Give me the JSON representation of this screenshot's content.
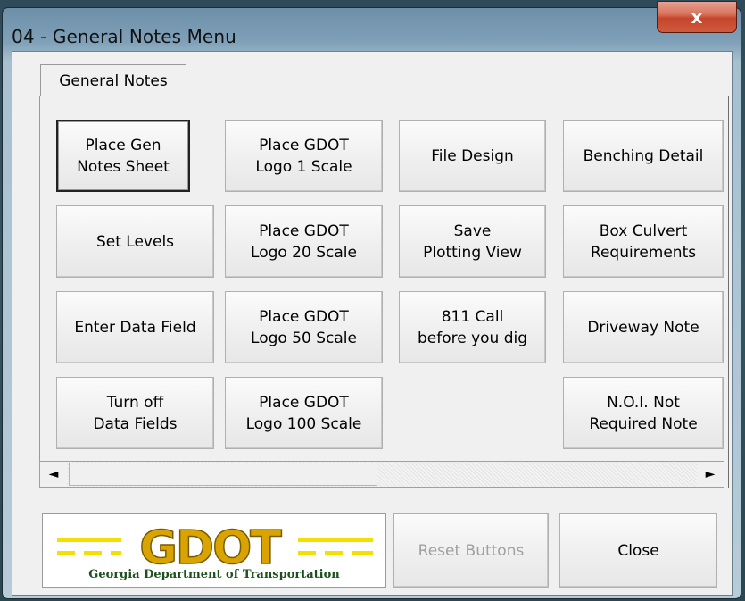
{
  "window": {
    "title": "04 - General Notes Menu",
    "close_glyph": "x"
  },
  "tabs": [
    {
      "label": "General Notes",
      "selected": true
    }
  ],
  "buttons": {
    "place_gen_notes_sheet": "Place Gen\nNotes Sheet",
    "place_gdot_logo_1": "Place GDOT\nLogo 1 Scale",
    "file_design": "File Design",
    "benching_detail": "Benching Detail",
    "set_levels": "Set Levels",
    "place_gdot_logo_20": "Place GDOT\nLogo 20 Scale",
    "save_plotting_view": "Save\nPlotting View",
    "box_culvert_requirements": "Box Culvert\nRequirements",
    "enter_data_field": "Enter Data Field",
    "place_gdot_logo_50": "Place GDOT\nLogo 50 Scale",
    "call_811": "811 Call\nbefore you dig",
    "driveway_note": "Driveway Note",
    "turn_off_data_fields": "Turn off\nData Fields",
    "place_gdot_logo_100": "Place GDOT\nLogo 100 Scale",
    "noi_not_required_note": "N.O.I. Not\nRequired Note"
  },
  "scrollbar": {
    "left_arrow": "◄",
    "right_arrow": "►"
  },
  "logo": {
    "wordmark": "GDOT",
    "caption": "Georgia Department of Transportation",
    "gold": "#d9a400",
    "yellow": "#f4e000",
    "green": "#1e4f1e"
  },
  "footer": {
    "reset_label": "Reset Buttons",
    "close_label": "Close"
  }
}
